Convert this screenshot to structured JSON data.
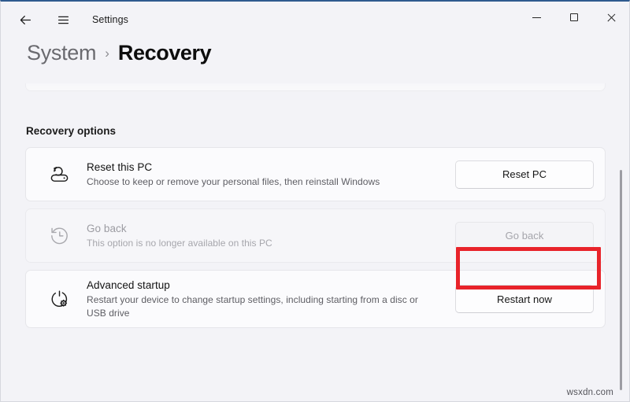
{
  "window": {
    "app_title": "Settings",
    "back_icon": "back-arrow-icon",
    "menu_icon": "hamburger-menu-icon",
    "controls": {
      "minimize": "minimize-icon",
      "maximize": "maximize-icon",
      "close": "close-icon"
    }
  },
  "breadcrumb": {
    "parent": "System",
    "separator": "›",
    "current": "Recovery"
  },
  "main": {
    "section_title": "Recovery options",
    "cards": [
      {
        "icon": "reset-pc-icon",
        "title": "Reset this PC",
        "description": "Choose to keep or remove your personal files, then reinstall Windows",
        "button_label": "Reset PC",
        "disabled": false
      },
      {
        "icon": "go-back-history-icon",
        "title": "Go back",
        "description": "This option is no longer available on this PC",
        "button_label": "Go back",
        "disabled": true
      },
      {
        "icon": "advanced-startup-icon",
        "title": "Advanced startup",
        "description": "Restart your device to change startup settings, including starting from a disc or USB drive",
        "button_label": "Restart now",
        "disabled": false
      }
    ]
  },
  "annotation": {
    "color": "#e8232a",
    "target": "Go back"
  },
  "watermark": {
    "text": "wsxdn.com"
  }
}
